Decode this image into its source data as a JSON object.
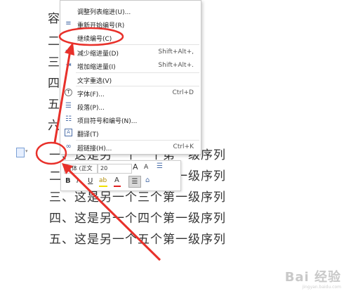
{
  "doc": {
    "partial_text": "容",
    "left_chars": [
      "二",
      "三",
      "四",
      "五",
      "六"
    ],
    "lines": [
      "一、这是另一个一个第一级序列",
      "二、这是另一个二个第一级序列",
      "三、这是另一个三个第一级序列",
      "四、这是另一个四个第一级序列",
      "五、这是另一个五个第一级序列"
    ]
  },
  "context_menu": {
    "items": [
      {
        "label": "调整列表缩进(U)...",
        "shortcut": "",
        "icon": "none"
      },
      {
        "label": "重新开始编号(R)",
        "shortcut": "",
        "icon": "restart-numbering-icon"
      },
      {
        "label": "继续编号(C)",
        "shortcut": "",
        "icon": "none"
      },
      {
        "label": "减少缩进量(D)",
        "shortcut": "Shift+Alt+,",
        "icon": "decrease-indent-icon"
      },
      {
        "label": "增加缩进量(I)",
        "shortcut": "Shift+Alt+.",
        "icon": "increase-indent-icon"
      },
      {
        "label": "文字重选(V)",
        "shortcut": "",
        "icon": "none"
      },
      {
        "label": "字体(F)...",
        "shortcut": "Ctrl+D",
        "icon": "font-icon"
      },
      {
        "label": "段落(P)...",
        "shortcut": "",
        "icon": "paragraph-icon"
      },
      {
        "label": "项目符号和编号(N)...",
        "shortcut": "",
        "icon": "bullets-numbering-icon"
      },
      {
        "label": "翻译(T)",
        "shortcut": "",
        "icon": "translate-icon"
      },
      {
        "label": "超链接(H)...",
        "shortcut": "Ctrl+K",
        "icon": "hyperlink-icon"
      }
    ]
  },
  "mini_toolbar": {
    "font_name": "宋体 (正文",
    "font_size": "20",
    "bold": "B",
    "italic": "I",
    "underline": "U",
    "font_color": "A",
    "grow_font": "A",
    "shrink_font": "A"
  },
  "watermark": {
    "text": "Bai 经验",
    "sub": "jingyan.baidu.com"
  },
  "colors": {
    "annotation": "#e8302a",
    "menu_border": "#c9c9c9",
    "icon_blue": "#4b6ea8"
  }
}
